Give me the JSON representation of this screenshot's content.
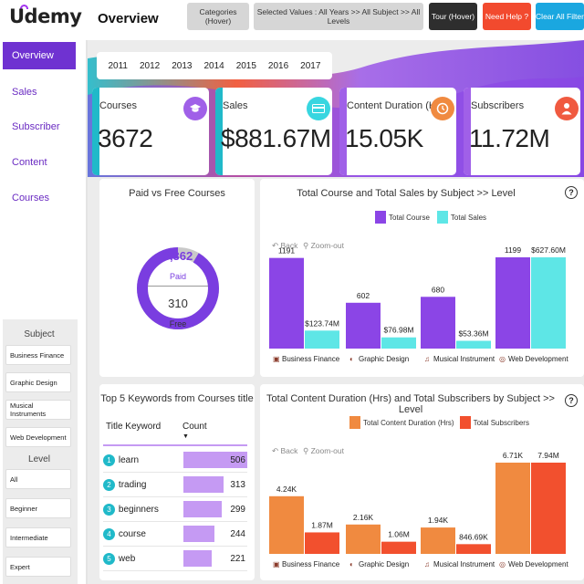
{
  "header": {
    "logo": "Udemy",
    "page_title": "Overview",
    "categories_btn": "Categories (Hover)",
    "selected_values": "Selected Values : All Years >> All Subject >> All Levels",
    "tour_btn": "Tour (Hover)",
    "help_btn": "Need Help ?",
    "clear_btn": "Clear All Filter"
  },
  "sidebar": {
    "items": [
      {
        "label": "Overview"
      },
      {
        "label": "Sales"
      },
      {
        "label": "Subscriber"
      },
      {
        "label": "Content"
      },
      {
        "label": "Courses"
      }
    ],
    "subject_head": "Subject",
    "subjects": [
      "Business Finance",
      "Graphic Design",
      "Musical Instruments",
      "Web Development"
    ],
    "level_head": "Level",
    "levels": [
      "All",
      "Beginner",
      "Intermediate",
      "Expert"
    ]
  },
  "years": [
    "2011",
    "2012",
    "2013",
    "2014",
    "2015",
    "2016",
    "2017"
  ],
  "kpis": [
    {
      "label": "Courses",
      "value": "3672",
      "icon": "graduation-cap-icon",
      "accent": "#20b9c9",
      "iconbg": "#a060e8"
    },
    {
      "label": "Sales",
      "value": "$881.67M",
      "icon": "credit-card-icon",
      "accent": "#20b9c9",
      "iconbg": "#38d6e0"
    },
    {
      "label": "Content Duration (Hrs)",
      "value": "15.05K",
      "icon": "clock-icon",
      "accent": "#a060e8",
      "iconbg": "#f08a40"
    },
    {
      "label": "Subscribers",
      "value": "11.72M",
      "icon": "person-icon",
      "accent": "#a060e8",
      "iconbg": "#f05a40"
    }
  ],
  "donut": {
    "title": "Paid vs Free Courses",
    "paid_value": "3,362",
    "paid_label": "Paid",
    "free_value": "310",
    "free_label": "Free",
    "paid": 3362,
    "free": 310,
    "paid_color": "#7a3de0",
    "free_color": "#c9c9c9"
  },
  "keywords": {
    "title": "Top 5 Keywords from Courses title",
    "col1": "Title Keyword",
    "col2": "Count",
    "rows": [
      {
        "rank": "1",
        "keyword": "learn",
        "count": 506
      },
      {
        "rank": "2",
        "keyword": "trading",
        "count": 313
      },
      {
        "rank": "3",
        "keyword": "beginners",
        "count": 299
      },
      {
        "rank": "4",
        "keyword": "course",
        "count": 244
      },
      {
        "rank": "5",
        "keyword": "web",
        "count": 221
      }
    ]
  },
  "chart_data": [
    {
      "type": "bar",
      "title": "Total Course and Total Sales by Subject >> Level",
      "categories": [
        "Business Finance",
        "Graphic Design",
        "Musical Instrument",
        "Web Development"
      ],
      "category_icons": [
        "briefcase-icon",
        "palette-icon",
        "music-note-icon",
        "globe-icon"
      ],
      "series": [
        {
          "name": "Total Course",
          "values": [
            1191,
            602,
            680,
            1199
          ],
          "labels": [
            "1191",
            "602",
            "680",
            "1199"
          ],
          "color": "#8b45e6"
        },
        {
          "name": "Total Sales",
          "values": [
            123.74,
            76.98,
            53.36,
            627.6
          ],
          "labels": [
            "$123.74M",
            "$76.98M",
            "$53.36M",
            "$627.60M"
          ],
          "color": "#5ee6e6"
        }
      ],
      "back_label": "Back",
      "zoom_label": "Zoom-out"
    },
    {
      "type": "bar",
      "title": "Total Content Duration (Hrs) and Total Subscribers by Subject >> Level",
      "categories": [
        "Business Finance",
        "Graphic Design",
        "Musical Instrument",
        "Web Development"
      ],
      "category_icons": [
        "briefcase-icon",
        "palette-icon",
        "music-note-icon",
        "globe-icon"
      ],
      "series": [
        {
          "name": "Total Content Duration (Hrs)",
          "values": [
            4240,
            2160,
            1940,
            6710
          ],
          "labels": [
            "4.24K",
            "2.16K",
            "1.94K",
            "6.71K"
          ],
          "color": "#f08a40"
        },
        {
          "name": "Total Subscribers",
          "values": [
            1870000,
            1060000,
            846690,
            7940000
          ],
          "labels": [
            "1.87M",
            "1.06M",
            "846.69K",
            "7.94M"
          ],
          "color": "#f2502e"
        }
      ],
      "back_label": "Back",
      "zoom_label": "Zoom-out"
    }
  ]
}
